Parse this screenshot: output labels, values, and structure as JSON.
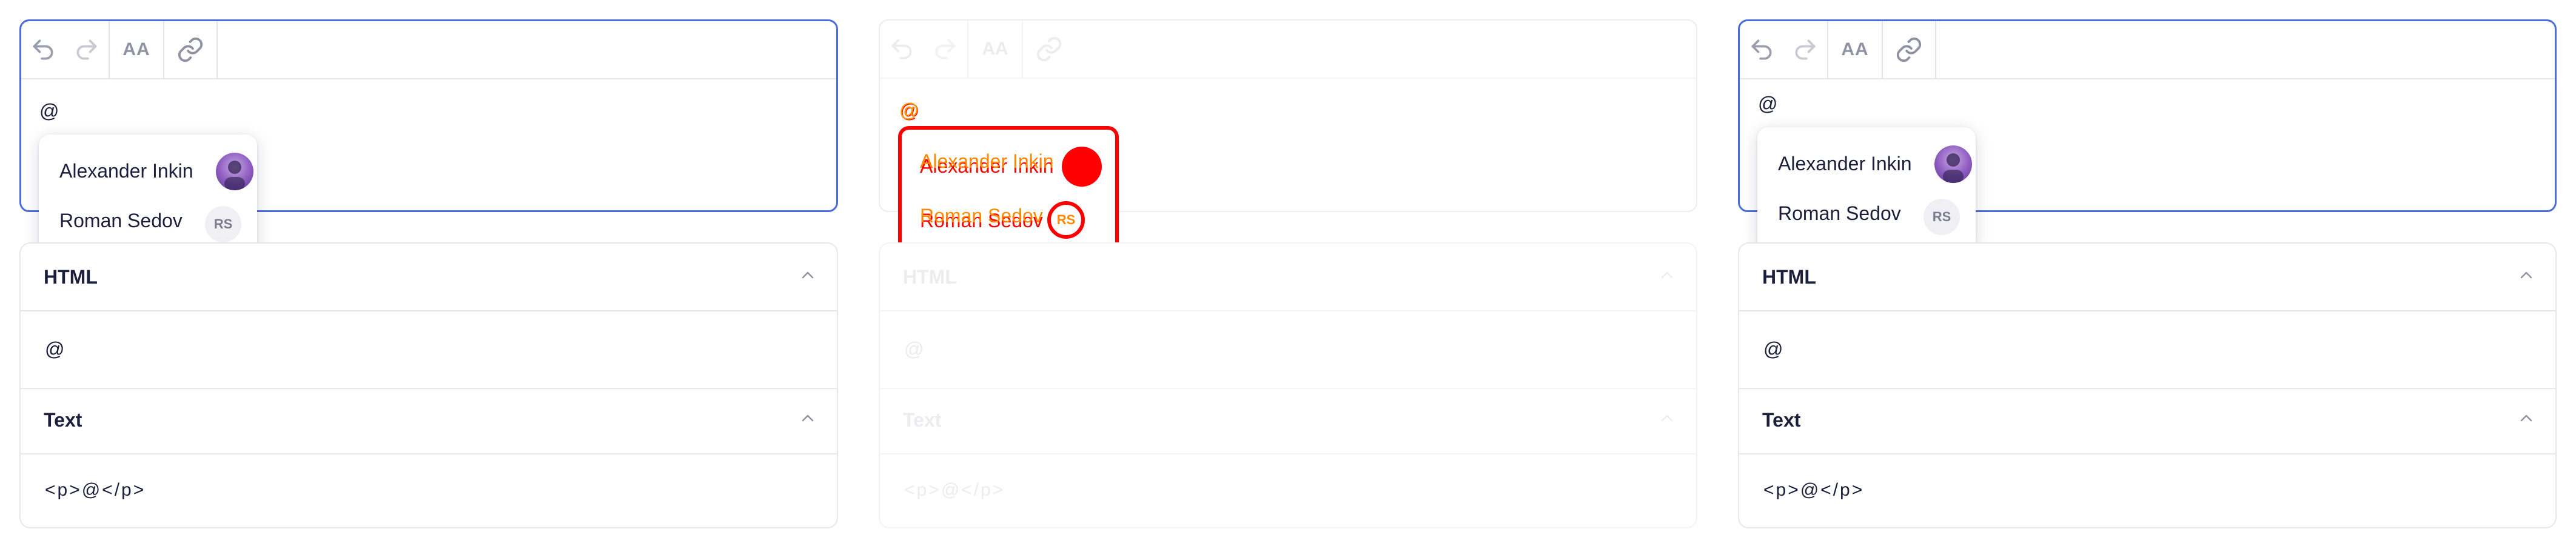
{
  "toolbar": {
    "undo_icon": "undo-icon",
    "redo_icon": "redo-icon",
    "font_label": "AA",
    "link_icon": "link-icon"
  },
  "editor": {
    "content": "@"
  },
  "mentions": [
    {
      "name": "Alexander Inkin",
      "avatar": "photo"
    },
    {
      "name": "Roman Sedov",
      "initials": "RS"
    }
  ],
  "sections": {
    "html": {
      "title": "HTML",
      "value": "@"
    },
    "text": {
      "title": "Text",
      "value": "<p>@</p>"
    }
  },
  "colors": {
    "accent": "#4a6be0",
    "diff": "#ff0000",
    "diff_text": "#ff8800"
  }
}
